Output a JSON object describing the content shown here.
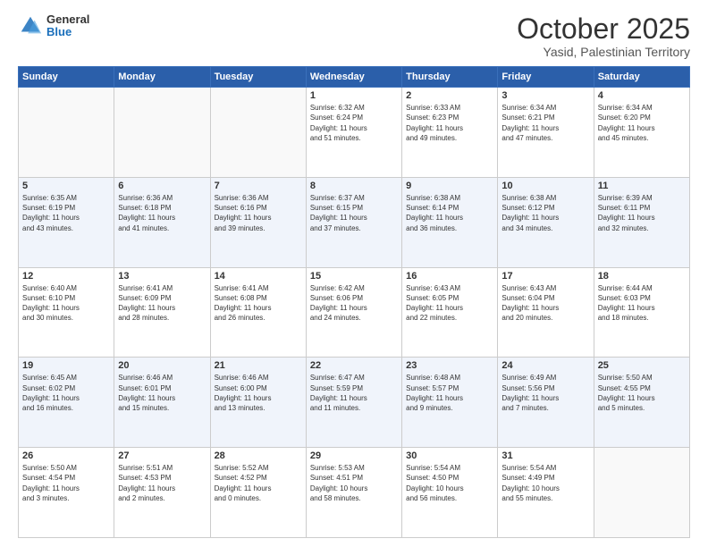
{
  "header": {
    "logo": {
      "general": "General",
      "blue": "Blue"
    },
    "title": "October 2025",
    "subtitle": "Yasid, Palestinian Territory"
  },
  "weekdays": [
    "Sunday",
    "Monday",
    "Tuesday",
    "Wednesday",
    "Thursday",
    "Friday",
    "Saturday"
  ],
  "weeks": [
    [
      {
        "day": "",
        "info": ""
      },
      {
        "day": "",
        "info": ""
      },
      {
        "day": "",
        "info": ""
      },
      {
        "day": "1",
        "info": "Sunrise: 6:32 AM\nSunset: 6:24 PM\nDaylight: 11 hours\nand 51 minutes."
      },
      {
        "day": "2",
        "info": "Sunrise: 6:33 AM\nSunset: 6:23 PM\nDaylight: 11 hours\nand 49 minutes."
      },
      {
        "day": "3",
        "info": "Sunrise: 6:34 AM\nSunset: 6:21 PM\nDaylight: 11 hours\nand 47 minutes."
      },
      {
        "day": "4",
        "info": "Sunrise: 6:34 AM\nSunset: 6:20 PM\nDaylight: 11 hours\nand 45 minutes."
      }
    ],
    [
      {
        "day": "5",
        "info": "Sunrise: 6:35 AM\nSunset: 6:19 PM\nDaylight: 11 hours\nand 43 minutes."
      },
      {
        "day": "6",
        "info": "Sunrise: 6:36 AM\nSunset: 6:18 PM\nDaylight: 11 hours\nand 41 minutes."
      },
      {
        "day": "7",
        "info": "Sunrise: 6:36 AM\nSunset: 6:16 PM\nDaylight: 11 hours\nand 39 minutes."
      },
      {
        "day": "8",
        "info": "Sunrise: 6:37 AM\nSunset: 6:15 PM\nDaylight: 11 hours\nand 37 minutes."
      },
      {
        "day": "9",
        "info": "Sunrise: 6:38 AM\nSunset: 6:14 PM\nDaylight: 11 hours\nand 36 minutes."
      },
      {
        "day": "10",
        "info": "Sunrise: 6:38 AM\nSunset: 6:12 PM\nDaylight: 11 hours\nand 34 minutes."
      },
      {
        "day": "11",
        "info": "Sunrise: 6:39 AM\nSunset: 6:11 PM\nDaylight: 11 hours\nand 32 minutes."
      }
    ],
    [
      {
        "day": "12",
        "info": "Sunrise: 6:40 AM\nSunset: 6:10 PM\nDaylight: 11 hours\nand 30 minutes."
      },
      {
        "day": "13",
        "info": "Sunrise: 6:41 AM\nSunset: 6:09 PM\nDaylight: 11 hours\nand 28 minutes."
      },
      {
        "day": "14",
        "info": "Sunrise: 6:41 AM\nSunset: 6:08 PM\nDaylight: 11 hours\nand 26 minutes."
      },
      {
        "day": "15",
        "info": "Sunrise: 6:42 AM\nSunset: 6:06 PM\nDaylight: 11 hours\nand 24 minutes."
      },
      {
        "day": "16",
        "info": "Sunrise: 6:43 AM\nSunset: 6:05 PM\nDaylight: 11 hours\nand 22 minutes."
      },
      {
        "day": "17",
        "info": "Sunrise: 6:43 AM\nSunset: 6:04 PM\nDaylight: 11 hours\nand 20 minutes."
      },
      {
        "day": "18",
        "info": "Sunrise: 6:44 AM\nSunset: 6:03 PM\nDaylight: 11 hours\nand 18 minutes."
      }
    ],
    [
      {
        "day": "19",
        "info": "Sunrise: 6:45 AM\nSunset: 6:02 PM\nDaylight: 11 hours\nand 16 minutes."
      },
      {
        "day": "20",
        "info": "Sunrise: 6:46 AM\nSunset: 6:01 PM\nDaylight: 11 hours\nand 15 minutes."
      },
      {
        "day": "21",
        "info": "Sunrise: 6:46 AM\nSunset: 6:00 PM\nDaylight: 11 hours\nand 13 minutes."
      },
      {
        "day": "22",
        "info": "Sunrise: 6:47 AM\nSunset: 5:59 PM\nDaylight: 11 hours\nand 11 minutes."
      },
      {
        "day": "23",
        "info": "Sunrise: 6:48 AM\nSunset: 5:57 PM\nDaylight: 11 hours\nand 9 minutes."
      },
      {
        "day": "24",
        "info": "Sunrise: 6:49 AM\nSunset: 5:56 PM\nDaylight: 11 hours\nand 7 minutes."
      },
      {
        "day": "25",
        "info": "Sunrise: 5:50 AM\nSunset: 4:55 PM\nDaylight: 11 hours\nand 5 minutes."
      }
    ],
    [
      {
        "day": "26",
        "info": "Sunrise: 5:50 AM\nSunset: 4:54 PM\nDaylight: 11 hours\nand 3 minutes."
      },
      {
        "day": "27",
        "info": "Sunrise: 5:51 AM\nSunset: 4:53 PM\nDaylight: 11 hours\nand 2 minutes."
      },
      {
        "day": "28",
        "info": "Sunrise: 5:52 AM\nSunset: 4:52 PM\nDaylight: 11 hours\nand 0 minutes."
      },
      {
        "day": "29",
        "info": "Sunrise: 5:53 AM\nSunset: 4:51 PM\nDaylight: 10 hours\nand 58 minutes."
      },
      {
        "day": "30",
        "info": "Sunrise: 5:54 AM\nSunset: 4:50 PM\nDaylight: 10 hours\nand 56 minutes."
      },
      {
        "day": "31",
        "info": "Sunrise: 5:54 AM\nSunset: 4:49 PM\nDaylight: 10 hours\nand 55 minutes."
      },
      {
        "day": "",
        "info": ""
      }
    ]
  ]
}
